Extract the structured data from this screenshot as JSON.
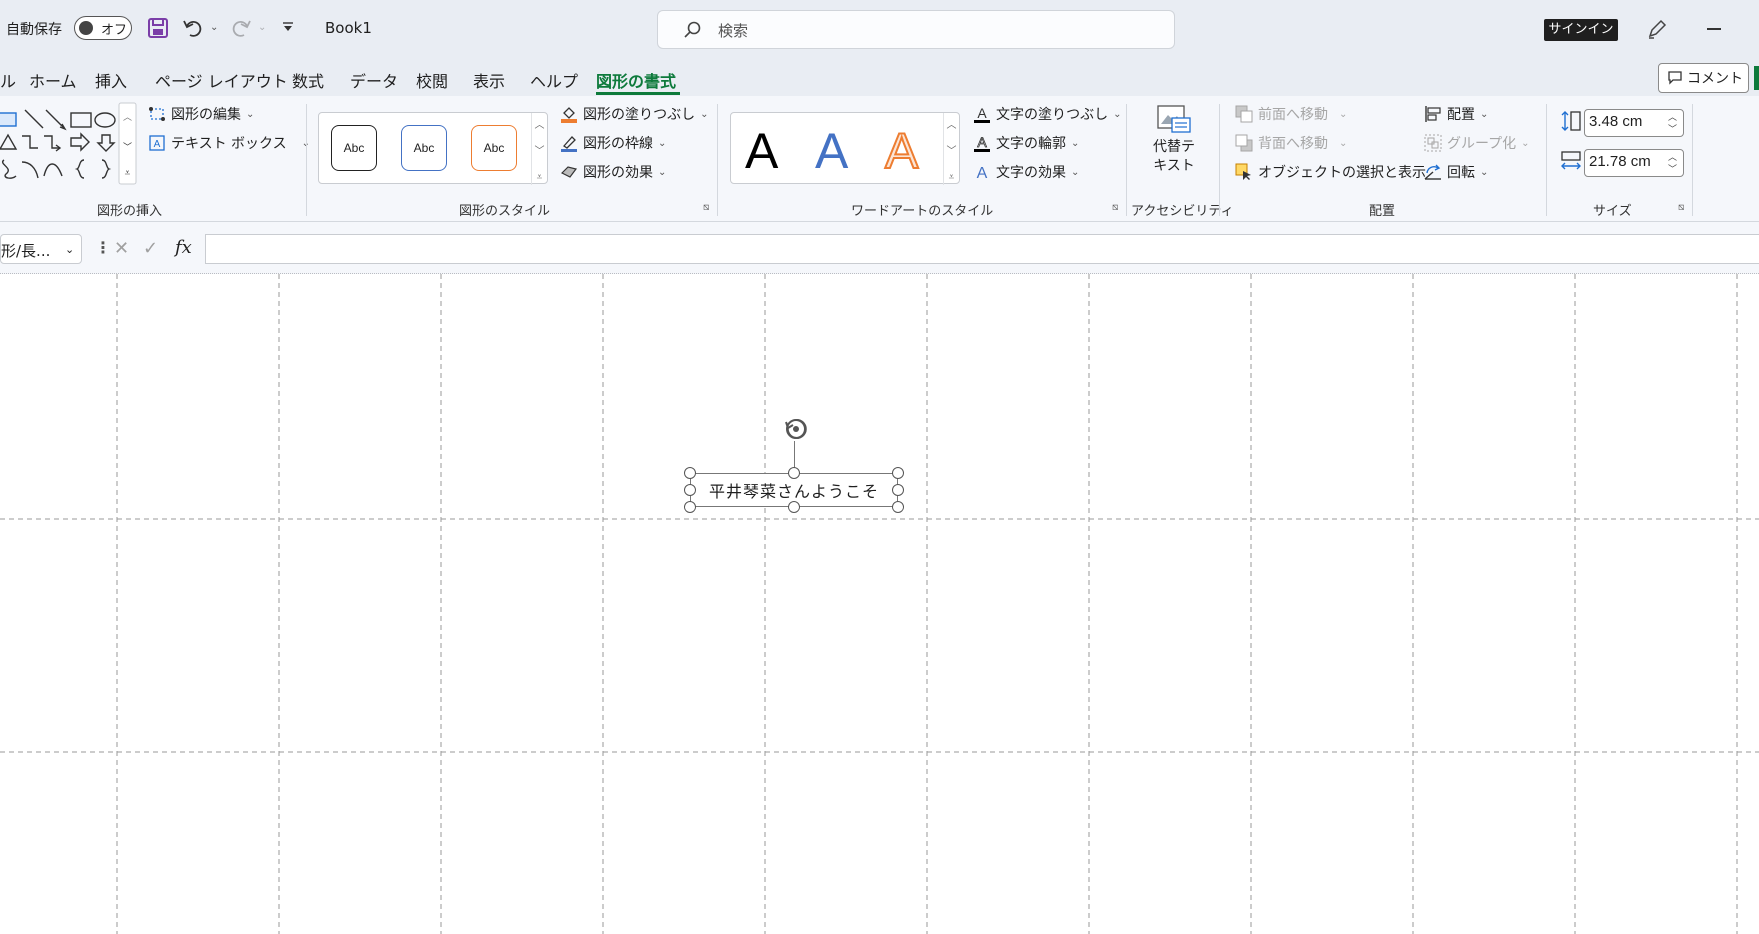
{
  "titlebar": {
    "autosave_label": "自動保存",
    "autosave_state": "オフ",
    "doc_title": "Book1",
    "search_placeholder": "検索",
    "signin_label": "サインイン"
  },
  "tabs": [
    {
      "label": "ル"
    },
    {
      "label": "ホーム"
    },
    {
      "label": "挿入"
    },
    {
      "label": "ページ レイアウト"
    },
    {
      "label": "数式"
    },
    {
      "label": "データ"
    },
    {
      "label": "校閲"
    },
    {
      "label": "表示"
    },
    {
      "label": "ヘルプ"
    },
    {
      "label": "図形の書式",
      "active": true
    }
  ],
  "comment_button": "コメント",
  "ribbon": {
    "insert_shapes": {
      "edit_shape": "図形の編集",
      "text_box": "テキスト ボックス",
      "group_label": "図形の挿入"
    },
    "shape_styles": {
      "swatches": [
        "Abc",
        "Abc",
        "Abc"
      ],
      "fill": "図形の塗りつぶし",
      "outline": "図形の枠線",
      "effects": "図形の効果",
      "group_label": "図形のスタイル"
    },
    "wordart_styles": {
      "samples": [
        "A",
        "A",
        "A"
      ],
      "text_fill": "文字の塗りつぶし",
      "text_outline": "文字の輪郭",
      "text_effects": "文字の効果",
      "group_label": "ワードアートのスタイル"
    },
    "accessibility": {
      "alt_text_line1": "代替テ",
      "alt_text_line2": "キスト",
      "group_label": "アクセシビリティ"
    },
    "arrange": {
      "bring_forward": "前面へ移動",
      "send_backward": "背面へ移動",
      "selection_pane": "オブジェクトの選択と表示",
      "align": "配置",
      "group": "グループ化",
      "rotate": "回転",
      "group_label": "配置"
    },
    "size": {
      "height": "3.48 cm",
      "width": "21.78 cm",
      "group_label": "サイズ"
    }
  },
  "formula_bar": {
    "name_box": "形/長...",
    "fx": "fx",
    "content": ""
  },
  "sheet": {
    "textbox_text": "平井琴菜さんようこそ"
  },
  "colors": {
    "accent_green": "#0d7a3b",
    "titlebar_bg": "#e9edf3",
    "ribbon_bg": "#f5f7fb",
    "wordart_blue": "#4472c4",
    "wordart_orange": "#ed7d31"
  }
}
